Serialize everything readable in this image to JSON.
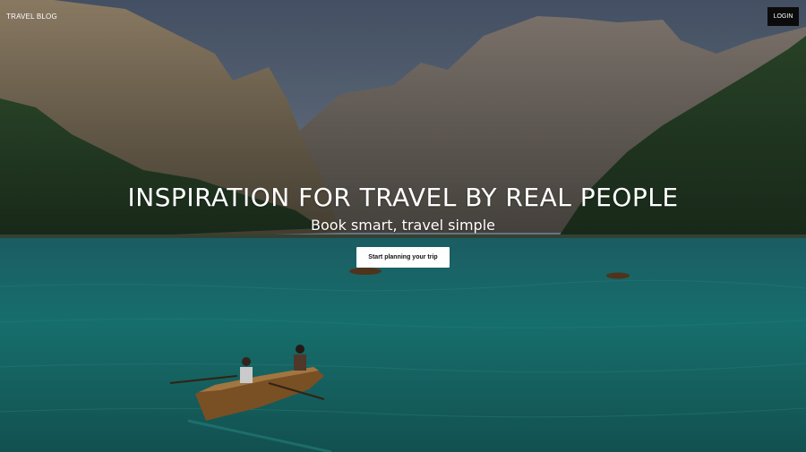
{
  "nav": {
    "brand": "TRAVEL BLOG",
    "login_label": "LOGIN"
  },
  "hero": {
    "headline": "INSPIRATION FOR TRAVEL BY REAL PEOPLE",
    "subhead": "Book smart, travel simple",
    "cta_label": "Start planning your trip"
  },
  "colors": {
    "login_bg": "#0b0b0b",
    "cta_bg": "#ffffff",
    "lake": "#1e6a6c",
    "sky": "#5f6f84"
  }
}
